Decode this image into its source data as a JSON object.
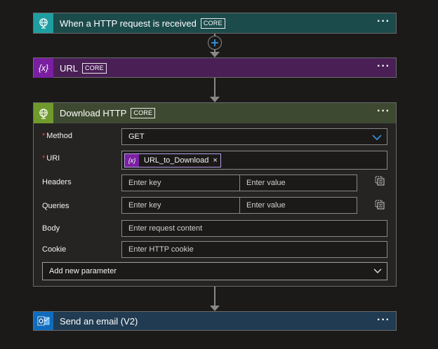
{
  "colors": {
    "request_header": "#1c4b4b",
    "request_icon_bg": "#1f9ea1",
    "variable_header": "#4a1f56",
    "variable_icon_bg": "#7a1fa2",
    "http_header": "#3d4a31",
    "http_icon_bg": "#709a2c",
    "email_header": "#203b52",
    "email_icon_bg": "#0f6cbd",
    "page_bg": "#1b1a19"
  },
  "trigger": {
    "title": "When a HTTP request is received",
    "badge": "CORE",
    "icon": "globe-icon",
    "more": "···"
  },
  "url_step": {
    "title": "URL",
    "badge": "CORE",
    "icon_text": "{x}",
    "more": "···"
  },
  "download_step": {
    "title": "Download HTTP",
    "badge": "CORE",
    "icon": "globe-icon",
    "more": "···",
    "method": {
      "label": "Method",
      "required": "*",
      "value": "GET"
    },
    "uri": {
      "label": "URI",
      "required": "*",
      "token_icon": "{x}",
      "token_text": "URL_to_Download",
      "token_remove": "×"
    },
    "headers": {
      "label": "Headers",
      "key_placeholder": "Enter key",
      "value_placeholder": "Enter value"
    },
    "queries": {
      "label": "Queries",
      "key_placeholder": "Enter key",
      "value_placeholder": "Enter value"
    },
    "body": {
      "label": "Body",
      "placeholder": "Enter request content"
    },
    "cookie": {
      "label": "Cookie",
      "placeholder": "Enter HTTP cookie"
    },
    "add_parameter": "Add new parameter"
  },
  "email_step": {
    "title": "Send an email (V2)",
    "icon": "outlook-icon",
    "more": "···"
  }
}
